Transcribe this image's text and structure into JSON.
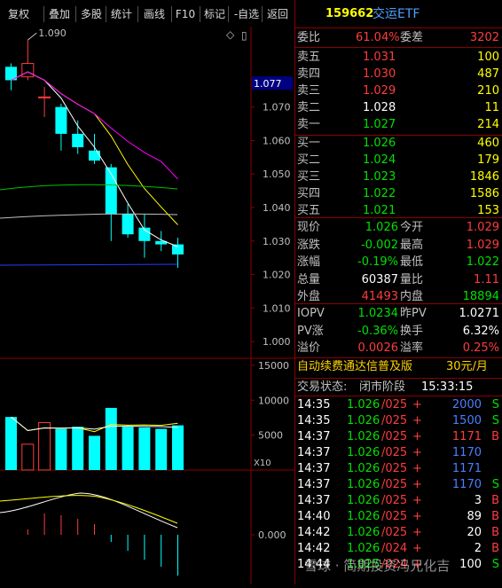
{
  "toolbar": {
    "items": [
      "复权",
      "叠加",
      "多股",
      "统计",
      "画线",
      "F10",
      "标记",
      "-自选",
      "返回"
    ]
  },
  "header": {
    "code": "159662",
    "name": "交运ETF",
    "commission_ratio_label": "委比",
    "commission_ratio": "61.04%",
    "commission_diff_label": "委差",
    "commission_diff": "3202"
  },
  "sells": [
    {
      "label": "卖五",
      "price": "1.031",
      "vol": "100"
    },
    {
      "label": "卖四",
      "price": "1.030",
      "vol": "487"
    },
    {
      "label": "卖三",
      "price": "1.029",
      "vol": "210"
    },
    {
      "label": "卖二",
      "price": "1.028",
      "vol": "11"
    },
    {
      "label": "卖一",
      "price": "1.027",
      "vol": "214"
    }
  ],
  "buys": [
    {
      "label": "买一",
      "price": "1.026",
      "vol": "460"
    },
    {
      "label": "买二",
      "price": "1.024",
      "vol": "179"
    },
    {
      "label": "买三",
      "price": "1.023",
      "vol": "1846"
    },
    {
      "label": "买四",
      "price": "1.022",
      "vol": "1586"
    },
    {
      "label": "买五",
      "price": "1.021",
      "vol": "153"
    }
  ],
  "quote": {
    "rows": [
      {
        "l1": "现价",
        "v1": "1.026",
        "c1": "green",
        "l2": "今开",
        "v2": "1.029",
        "c2": "red"
      },
      {
        "l1": "涨跌",
        "v1": "-0.002",
        "c1": "green",
        "l2": "最高",
        "v2": "1.029",
        "c2": "red"
      },
      {
        "l1": "涨幅",
        "v1": "-0.19%",
        "c1": "green",
        "l2": "最低",
        "v2": "1.022",
        "c2": "green"
      },
      {
        "l1": "总量",
        "v1": "60387",
        "c1": "white",
        "l2": "量比",
        "v2": "1.11",
        "c2": "red"
      },
      {
        "l1": "外盘",
        "v1": "41493",
        "c1": "red",
        "l2": "内盘",
        "v2": "18894",
        "c2": "green"
      }
    ]
  },
  "iopv": {
    "rows": [
      {
        "l1": "IOPV",
        "v1": "1.0234",
        "c1": "green",
        "l2": "昨PV",
        "v2": "1.0271",
        "c2": "white"
      },
      {
        "l1": "PV涨",
        "v1": "-0.36%",
        "c1": "green",
        "l2": "换手",
        "v2": "6.32%",
        "c2": "white"
      },
      {
        "l1": "溢价",
        "v1": "0.0026",
        "c1": "red",
        "l2": "溢率",
        "v2": "0.25%",
        "c2": "red"
      }
    ]
  },
  "promo": {
    "text": "自动续费通达信普及版",
    "price": "30元/月"
  },
  "trade_status": {
    "label": "交易状态:",
    "status": "闭市阶段",
    "time": "15:33:15"
  },
  "ticks": [
    {
      "time": "14:35",
      "price": "1.026",
      "price2": "/025",
      "sign": "+",
      "vol": "2000",
      "vc": "blue",
      "side": "S"
    },
    {
      "time": "14:35",
      "price": "1.026",
      "price2": "/025",
      "sign": "+",
      "vol": "1500",
      "vc": "blue",
      "side": "S"
    },
    {
      "time": "14:37",
      "price": "1.026",
      "price2": "/025",
      "sign": "+",
      "vol": "1171",
      "vc": "red",
      "side": "B"
    },
    {
      "time": "14:37",
      "price": "1.026",
      "price2": "/025",
      "sign": "+",
      "vol": "1170",
      "vc": "blue",
      "side": ""
    },
    {
      "time": "14:37",
      "price": "1.026",
      "price2": "/025",
      "sign": "+",
      "vol": "1171",
      "vc": "blue",
      "side": ""
    },
    {
      "time": "14:37",
      "price": "1.026",
      "price2": "/025",
      "sign": "+",
      "vol": "1170",
      "vc": "blue",
      "side": "S"
    },
    {
      "time": "14:37",
      "price": "1.026",
      "price2": "/025",
      "sign": "+",
      "vol": "3",
      "vc": "white",
      "side": "B"
    },
    {
      "time": "14:40",
      "price": "1.026",
      "price2": "/025",
      "sign": "+",
      "vol": "89",
      "vc": "white",
      "side": "B"
    },
    {
      "time": "14:42",
      "price": "1.026",
      "price2": "/025",
      "sign": "+",
      "vol": "20",
      "vc": "white",
      "side": "B"
    },
    {
      "time": "14:42",
      "price": "1.026",
      "price2": "/024",
      "sign": "+",
      "vol": "2",
      "vc": "white",
      "side": "B"
    },
    {
      "time": "14:44",
      "price": "1.025",
      "price2": "/024",
      "sign": "+",
      "vol": "100",
      "vc": "white",
      "side": "S"
    }
  ],
  "watermark": "雪球 · 简期投资冯兄化吉",
  "chart_data": [
    {
      "type": "candlestick",
      "y_ticks": [
        "1.070",
        "1.060",
        "1.050",
        "1.040",
        "1.030",
        "1.020",
        "1.010",
        "1.000"
      ],
      "current_price_tag": "1.077",
      "high_annotation": "1.090",
      "candles": [
        {
          "o": 1.082,
          "h": 1.083,
          "l": 1.075,
          "c": 1.078
        },
        {
          "o": 1.079,
          "h": 1.09,
          "l": 1.078,
          "c": 1.083
        },
        {
          "o": 1.073,
          "h": 1.076,
          "l": 1.067,
          "c": 1.073
        },
        {
          "o": 1.07,
          "h": 1.071,
          "l": 1.057,
          "c": 1.062
        },
        {
          "o": 1.062,
          "h": 1.066,
          "l": 1.056,
          "c": 1.058
        },
        {
          "o": 1.057,
          "h": 1.062,
          "l": 1.053,
          "c": 1.054
        },
        {
          "o": 1.052,
          "h": 1.053,
          "l": 1.03,
          "c": 1.038
        },
        {
          "o": 1.038,
          "h": 1.041,
          "l": 1.031,
          "c": 1.032
        },
        {
          "o": 1.034,
          "h": 1.038,
          "l": 1.025,
          "c": 1.03
        },
        {
          "o": 1.03,
          "h": 1.033,
          "l": 1.027,
          "c": 1.029
        },
        {
          "o": 1.029,
          "h": 1.031,
          "l": 1.022,
          "c": 1.026
        }
      ],
      "y_range": [
        0.995,
        1.094
      ]
    },
    {
      "type": "bar",
      "y_ticks": [
        "15000",
        "10000",
        "5000"
      ],
      "unit_label": "X10",
      "values": [
        7600,
        3700,
        6800,
        5900,
        6200,
        4900,
        8900,
        6200,
        6100,
        5900,
        6400
      ],
      "ma_lines": [
        "yellow",
        "white"
      ],
      "y_range": [
        0,
        16000
      ]
    },
    {
      "type": "line",
      "y_ticks": [
        "0.000"
      ],
      "y_range": [
        -0.006,
        0.006
      ]
    }
  ]
}
